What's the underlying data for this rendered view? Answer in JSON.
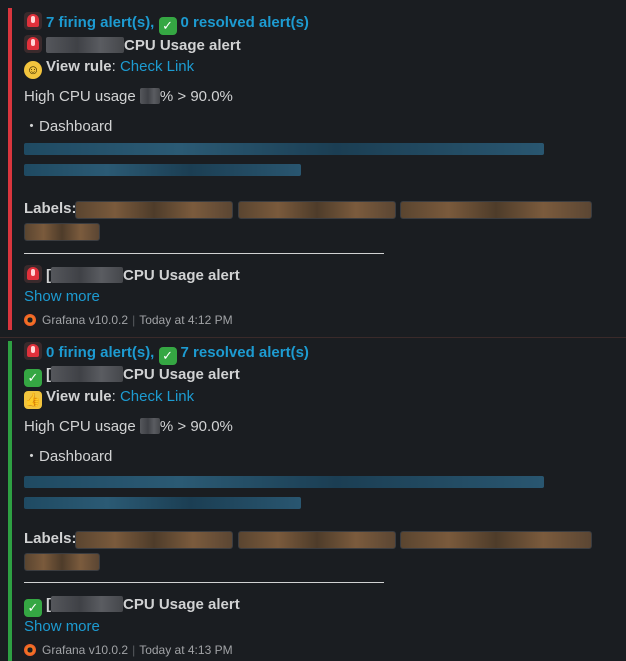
{
  "messages": [
    {
      "status_color": "#d9363e",
      "summary": {
        "firing": "7 firing alert(s),",
        "resolved": "0 resolved alert(s)"
      },
      "title_prefix_icon": "siren-icon",
      "title": "CPU Usage alert",
      "rule_icon": "halo-face-icon",
      "view_rule_label": "View rule",
      "view_rule_sep": ":",
      "view_rule_link": "Check Link",
      "description_prefix": "High CPU usage ",
      "description_suffix": "% > 90.0%",
      "dashboard_label": "・Dashboard",
      "labels_label": "Labels:",
      "next_icon": "siren-icon",
      "next_prefix": "[",
      "next_title": "CPU Usage alert",
      "show_more": "Show more",
      "app": "Grafana v10.0.2",
      "time": "Today at 4:12 PM"
    },
    {
      "status_color": "#2ea043",
      "summary": {
        "firing": "0 firing alert(s),",
        "resolved": "7 resolved alert(s)"
      },
      "title_prefix_icon": "check-icon",
      "title_prefix": "[",
      "title": "CPU Usage alert",
      "rule_icon": "thumbs-up-icon",
      "view_rule_label": "View rule",
      "view_rule_sep": ":",
      "view_rule_link": "Check Link",
      "description_prefix": "High CPU usage ",
      "description_suffix": "% > 90.0%",
      "dashboard_label": "・Dashboard",
      "labels_label": "Labels:",
      "next_icon": "check-icon",
      "next_prefix": "[",
      "next_title": "CPU Usage alert",
      "show_more": "Show more",
      "app": "Grafana v10.0.2",
      "time": "Today at 4:13 PM"
    }
  ]
}
